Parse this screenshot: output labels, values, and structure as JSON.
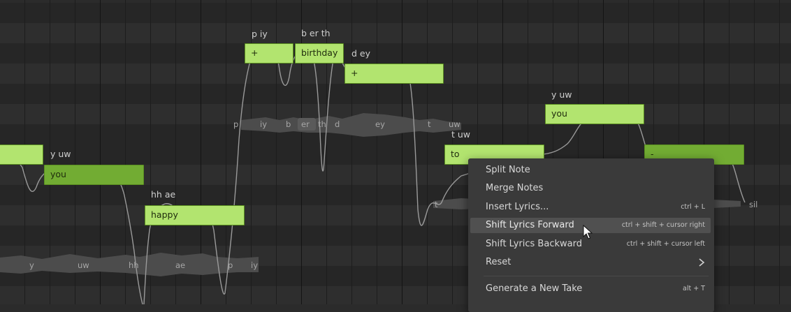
{
  "notes": [
    {
      "id": "note-partial-left",
      "text": "",
      "style": "light"
    },
    {
      "id": "note-you-1",
      "text": "you",
      "style": "dark"
    },
    {
      "id": "note-happy",
      "text": "happy",
      "style": "light"
    },
    {
      "id": "note-plus-1",
      "text": "+",
      "style": "light"
    },
    {
      "id": "note-birthday",
      "text": "birthday",
      "style": "light"
    },
    {
      "id": "note-plus-2",
      "text": "+",
      "style": "light"
    },
    {
      "id": "note-to",
      "text": "to",
      "style": "light"
    },
    {
      "id": "note-you-2",
      "text": "you",
      "style": "light"
    },
    {
      "id": "note-dash",
      "text": "-",
      "style": "dark"
    }
  ],
  "phonemes": {
    "y_uw_1": "y uw",
    "hh_ae": "hh ae",
    "p_iy": "p iy",
    "b_er_th": "b er th",
    "d_ey": "d ey",
    "t_uw": "t uw",
    "y_uw_2": "y uw"
  },
  "waveform_labels": {
    "upper": [
      "p",
      "iy",
      "b",
      "er",
      "th",
      "d",
      "ey",
      "t",
      "uw"
    ],
    "lower": [
      "y",
      "uw",
      "hh",
      "ae",
      "p",
      "iy"
    ],
    "right": [
      "t",
      "sil"
    ]
  },
  "context_menu": {
    "items": [
      {
        "label": "Split Note",
        "shortcut": ""
      },
      {
        "label": "Merge Notes",
        "shortcut": ""
      },
      {
        "label": "Insert Lyrics...",
        "shortcut": "ctrl + L"
      },
      {
        "label": "Shift Lyrics Forward",
        "shortcut": "ctrl + shift + cursor right"
      },
      {
        "label": "Shift Lyrics Backward",
        "shortcut": "ctrl + shift + cursor left"
      },
      {
        "label": "Reset",
        "shortcut": ""
      },
      {
        "label": "Generate a New Take",
        "shortcut": "alt + T"
      }
    ],
    "hovered": "Shift Lyrics Forward"
  },
  "colors": {
    "note_light": "#b2e46f",
    "note_dark": "#72ac33",
    "pitch_curve": "#9a9a9a",
    "menu_bg": "#3a3a3a",
    "menu_hover": "#505050"
  }
}
